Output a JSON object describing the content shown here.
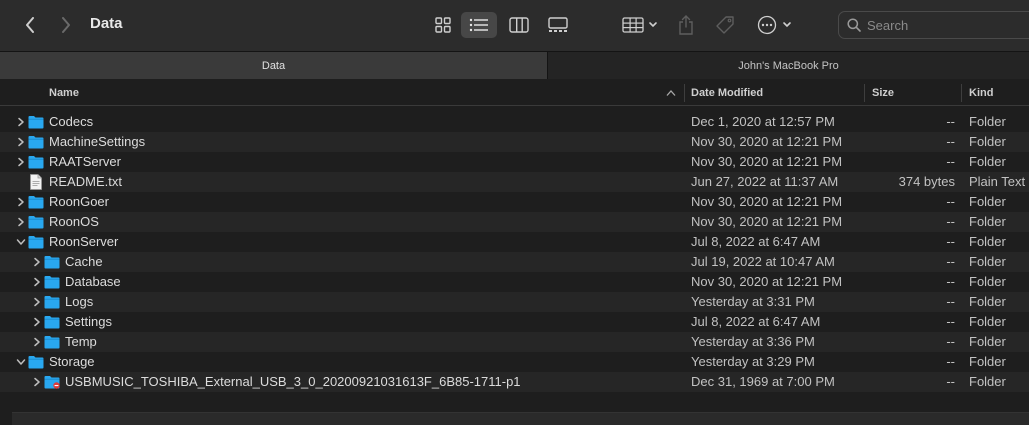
{
  "window": {
    "title": "Data"
  },
  "toolbar": {
    "search_placeholder": "Search",
    "icons": [
      "chevron-left-icon",
      "chevron-right-icon",
      "grid-view-icon",
      "list-view-icon",
      "columns-view-icon",
      "gallery-view-icon",
      "group-icon",
      "share-icon",
      "tag-icon",
      "more-icon",
      "search-icon"
    ]
  },
  "tabs": [
    {
      "label": "Data",
      "active": true
    },
    {
      "label": "John's MacBook Pro",
      "active": false
    }
  ],
  "columns": {
    "name": "Name",
    "date": "Date Modified",
    "size": "Size",
    "kind": "Kind"
  },
  "rows": [
    {
      "name": "Codecs",
      "date": "Dec 1, 2020 at 12:57 PM",
      "size": "--",
      "kind": "Folder",
      "level": 0,
      "type": "folder",
      "expanded": false
    },
    {
      "name": "MachineSettings",
      "date": "Nov 30, 2020 at 12:21 PM",
      "size": "--",
      "kind": "Folder",
      "level": 0,
      "type": "folder",
      "expanded": false
    },
    {
      "name": "RAATServer",
      "date": "Nov 30, 2020 at 12:21 PM",
      "size": "--",
      "kind": "Folder",
      "level": 0,
      "type": "folder",
      "expanded": false
    },
    {
      "name": "README.txt",
      "date": "Jun 27, 2022 at 11:37 AM",
      "size": "374 bytes",
      "kind": "Plain Text",
      "level": 0,
      "type": "file"
    },
    {
      "name": "RoonGoer",
      "date": "Nov 30, 2020 at 12:21 PM",
      "size": "--",
      "kind": "Folder",
      "level": 0,
      "type": "folder",
      "expanded": false
    },
    {
      "name": "RoonOS",
      "date": "Nov 30, 2020 at 12:21 PM",
      "size": "--",
      "kind": "Folder",
      "level": 0,
      "type": "folder",
      "expanded": false
    },
    {
      "name": "RoonServer",
      "date": "Jul 8, 2022 at 6:47 AM",
      "size": "--",
      "kind": "Folder",
      "level": 0,
      "type": "folder",
      "expanded": true
    },
    {
      "name": "Cache",
      "date": "Jul 19, 2022 at 10:47 AM",
      "size": "--",
      "kind": "Folder",
      "level": 1,
      "type": "folder",
      "expanded": false
    },
    {
      "name": "Database",
      "date": "Nov 30, 2020 at 12:21 PM",
      "size": "--",
      "kind": "Folder",
      "level": 1,
      "type": "folder",
      "expanded": false
    },
    {
      "name": "Logs",
      "date": "Yesterday at 3:31 PM",
      "size": "--",
      "kind": "Folder",
      "level": 1,
      "type": "folder",
      "expanded": false
    },
    {
      "name": "Settings",
      "date": "Jul 8, 2022 at 6:47 AM",
      "size": "--",
      "kind": "Folder",
      "level": 1,
      "type": "folder",
      "expanded": false
    },
    {
      "name": "Temp",
      "date": "Yesterday at 3:36 PM",
      "size": "--",
      "kind": "Folder",
      "level": 1,
      "type": "folder",
      "expanded": false
    },
    {
      "name": "Storage",
      "date": "Yesterday at 3:29 PM",
      "size": "--",
      "kind": "Folder",
      "level": 0,
      "type": "folder",
      "expanded": true
    },
    {
      "name": "USBMUSIC_TOSHIBA_External_USB_3_0_20200921031613F_6B85-1711-p1",
      "date": "Dec 31, 1969 at 7:00 PM",
      "size": "--",
      "kind": "Folder",
      "level": 1,
      "type": "restricted-folder"
    }
  ],
  "colors": {
    "folder": "#29a8f0",
    "accent": "#e8e8e8",
    "restricted": "#e03c3c"
  }
}
